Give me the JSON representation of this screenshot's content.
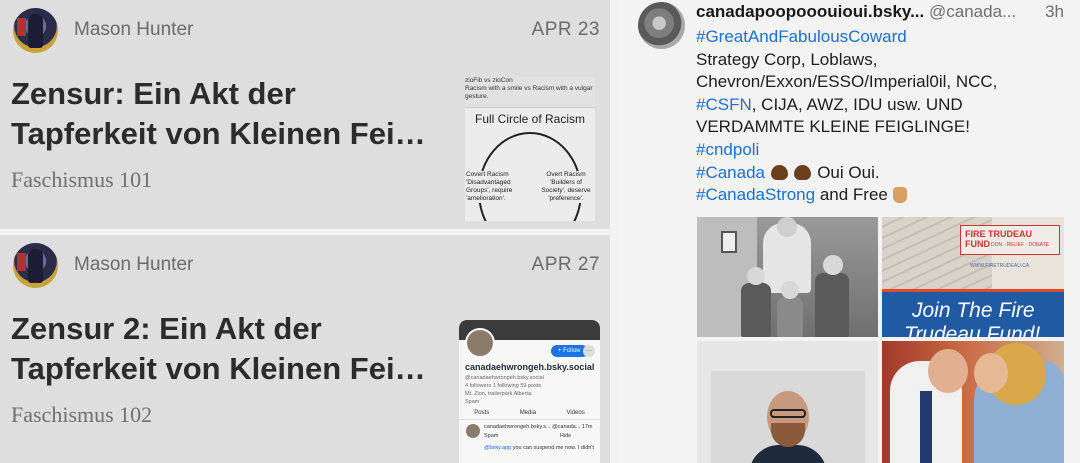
{
  "cards": [
    {
      "author": "Mason Hunter",
      "date": "APR 23",
      "title": "Zensur: Ein Akt der Tapferkeit von Kleinen Fei…",
      "publication": "Faschismus 101",
      "thumbnail": {
        "header_line1": "zioFib vs zioCon",
        "header_line2": "Racism with a smile vs Racism with a vulgar gesture.",
        "title": "Full Circle of Racism",
        "left_label": "Covert Racism",
        "left_sub": "'Disadvantaged Groups', require 'amelioration'.",
        "right_label": "Overt Racism",
        "right_sub": "'Builders of Society', deserve 'preference'."
      }
    },
    {
      "author": "Mason Hunter",
      "date": "APR 27",
      "title": "Zensur 2: Ein Akt der Tapferkeit von Kleinen Fei…",
      "publication": "Faschismus 102",
      "thumbnail": {
        "follow": "+ Follow",
        "more": "···",
        "name": "canadaehwrongeh.bsky.social",
        "handle": "@canadaehwrongeh.bsky.social",
        "stats": "4 followers 1 following 59 posts",
        "bio": "Mt. Zion, trailerpark Alberta.",
        "spam": "Spam",
        "tabs": [
          "Posts",
          "Media",
          "Videos"
        ],
        "post_author": "canadaehwrongeh.bsky.s...  @canada...  17m",
        "post_spam": "Spam",
        "post_hide": "Hide",
        "post_link": "@bsky.app",
        "post_text": " you can suspend me now. I didn't"
      }
    }
  ],
  "post": {
    "display_name": "canadapoopooouioui.bsky...",
    "handle": "@canada...",
    "time": "3h",
    "tag_great": "#GreatAndFabulousCoward",
    "line_strategy": "Strategy Corp, Loblaws,",
    "line_chevron": "Chevron/Exxon/ESSO/Imperial0il, NCC,",
    "tag_csfn": "#CSFN",
    "line_cija": ", CIJA, AWZ, IDU usw. UND",
    "line_verdammte": "VERDAMMTE KLEINE FEIGLINGE!",
    "tag_cndpoli": "#cndpoli",
    "tag_canada": "#Canada",
    "line_oui": " Oui Oui.",
    "tag_canadastrong": "#CanadaStrong",
    "line_free": " and Free ",
    "images": [
      {
        "name": "family-photo"
      },
      {
        "name": "fire-trudeau-fund",
        "sign": "FIRE TRUDEAU FUND",
        "sign_sub": "DON · RELIEF · DONATE",
        "url": "WWW.FIRETRUDEAU.CA",
        "line1": "Join The Fire",
        "line2": "Trudeau Fund!"
      },
      {
        "name": "portrait-photo"
      },
      {
        "name": "kiss-photo"
      }
    ]
  }
}
